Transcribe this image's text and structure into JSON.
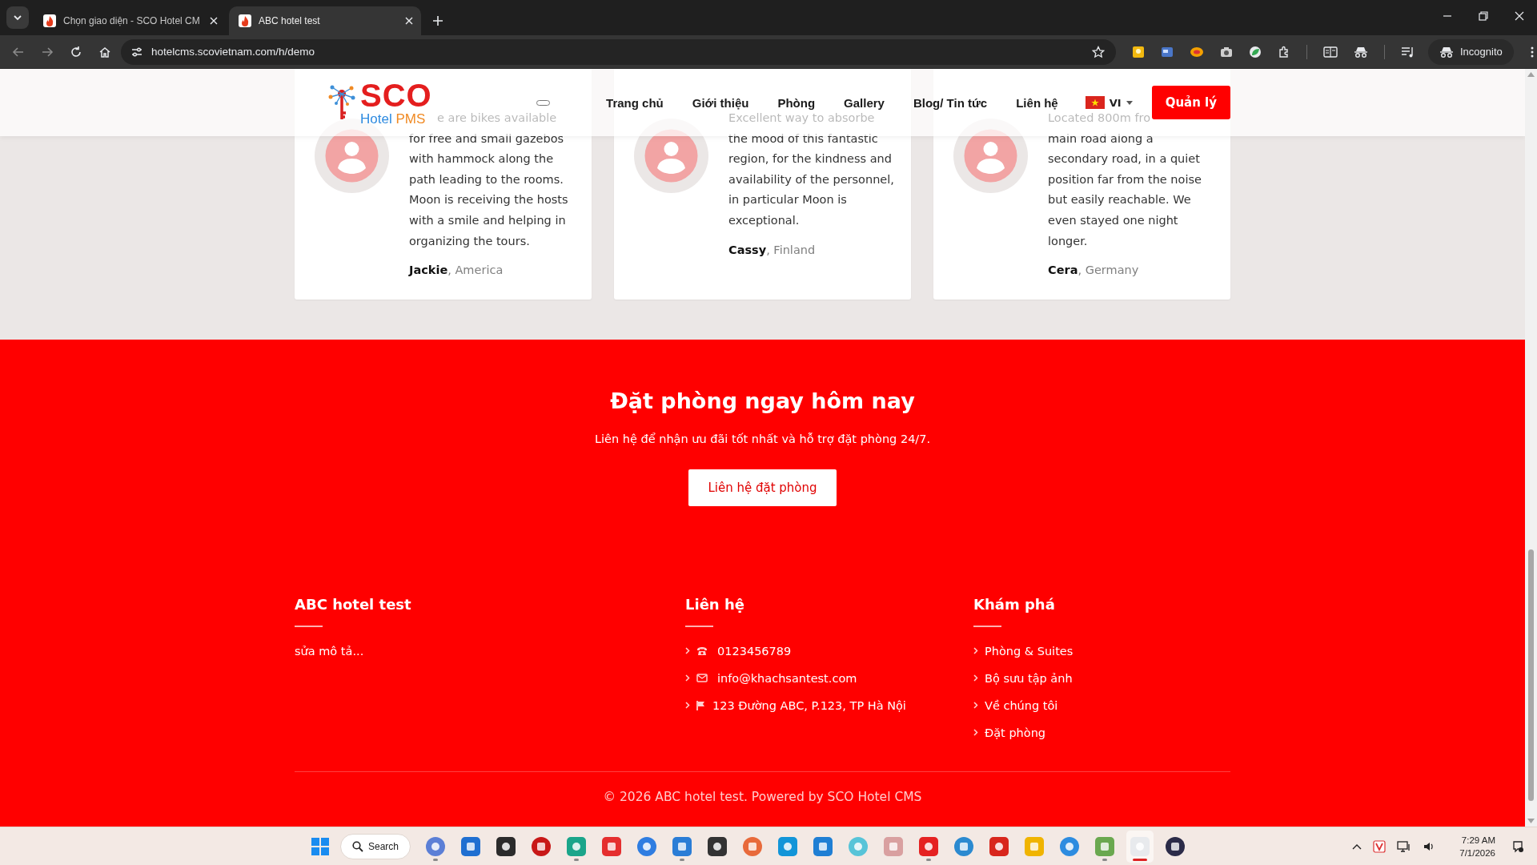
{
  "browser": {
    "tabs": [
      {
        "title": "Chọn giao diện - SCO Hotel CM",
        "selected": false
      },
      {
        "title": "ABC hotel test",
        "selected": true
      }
    ],
    "url": "hotelcms.scovietnam.com/h/demo",
    "profile": "Incognito"
  },
  "header": {
    "logo": {
      "name": "SCO",
      "tagline_1": "Hotel",
      "tagline_2": "PMS"
    },
    "nav": [
      "Trang chủ",
      "Giới thiệu",
      "Phòng",
      "Gallery",
      "Blog/ Tin tức",
      "Liên hệ"
    ],
    "language": "VI",
    "admin_button": "Quản lý"
  },
  "testimonials": [
    {
      "faded_line": "e are bikes available",
      "lines": [
        "for free and small gazebos",
        "with hammock along the",
        "path leading to the rooms.",
        "Moon is receiving the hosts",
        "with a smile and helping in",
        "organizing the tours."
      ],
      "byline": "**Jackie**, America"
    },
    {
      "faded_line": "Excellent way to absorbe",
      "lines": [
        "the mood of this fantastic",
        "region, for the kindness and",
        "availability of the personnel,",
        "in particular Moon is",
        "exceptional."
      ],
      "byline": "**Cassy**, Finland"
    },
    {
      "faded_line": "Located 800m fro",
      "lines": [
        "main road along a",
        "secondary road, in a quiet",
        "position far from the noise",
        "but easily reachable. We",
        "even stayed one night",
        "longer."
      ],
      "byline": "**Cera**, Germany"
    }
  ],
  "booking_cta": {
    "title": "Đặt phòng ngay hôm nay",
    "subtitle": "Liên hệ để nhận ưu đãi tốt nhất và hỗ trợ đặt phòng 24/7.",
    "button": "Liên hệ đặt phòng"
  },
  "footer": {
    "about": {
      "heading": "ABC hotel test",
      "text": "sửa mô tả..."
    },
    "contact": {
      "heading": "Liên hệ",
      "items": [
        {
          "kind": "phone",
          "text": "0123456789"
        },
        {
          "kind": "email",
          "text": "info@khachsantest.com"
        },
        {
          "kind": "address",
          "text": "123 Đường ABC, P.123, TP Hà Nội"
        }
      ]
    },
    "explore": {
      "heading": "Khám phá",
      "links": [
        "Phòng & Suites",
        "Bộ sưu tập ảnh",
        "Về chúng tôi",
        "Đặt phòng"
      ]
    },
    "copyright": "© 2026 ABC hotel test. Powered by SCO Hotel CMS"
  },
  "taskbar": {
    "search": "Search",
    "apps": [
      {
        "running": true,
        "selected": false
      },
      {
        "running": false,
        "selected": false
      },
      {
        "running": false,
        "selected": false
      },
      {
        "running": false,
        "selected": false
      },
      {
        "running": true,
        "selected": false
      },
      {
        "running": false,
        "selected": false
      },
      {
        "running": false,
        "selected": false
      },
      {
        "running": true,
        "selected": false
      },
      {
        "running": false,
        "selected": false
      },
      {
        "running": false,
        "selected": false
      },
      {
        "running": false,
        "selected": false
      },
      {
        "running": false,
        "selected": false
      },
      {
        "running": false,
        "selected": false
      },
      {
        "running": false,
        "selected": false
      },
      {
        "running": true,
        "selected": false
      },
      {
        "running": false,
        "selected": false
      },
      {
        "running": false,
        "selected": false
      },
      {
        "running": false,
        "selected": false
      },
      {
        "running": false,
        "selected": false
      },
      {
        "running": true,
        "selected": false
      },
      {
        "running": true,
        "selected": true
      },
      {
        "running": false,
        "selected": false
      }
    ],
    "time": "7:29 AM",
    "date": "7/1/2026"
  }
}
